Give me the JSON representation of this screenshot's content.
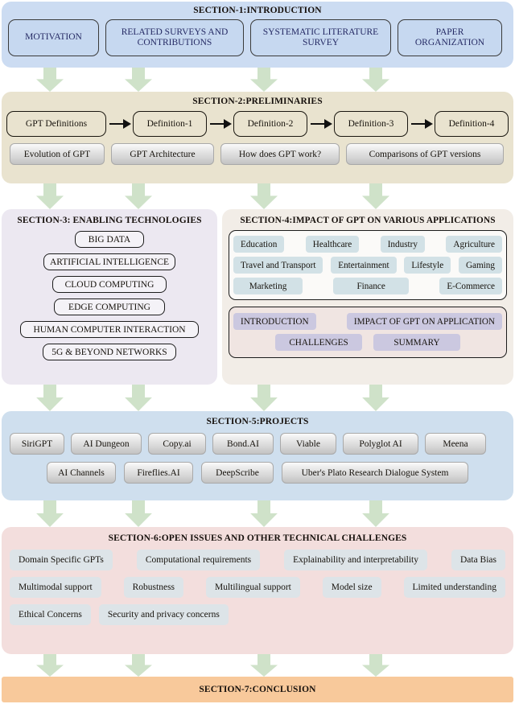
{
  "sections": {
    "s1": {
      "title": "SECTION-1:INTRODUCTION",
      "items": [
        "MOTIVATION",
        "RELATED SURVEYS AND CONTRIBUTIONS",
        "SYSTEMATIC LITERATURE SURVEY",
        "PAPER ORGANIZATION"
      ]
    },
    "s2": {
      "title": "SECTION-2:PRELIMINARIES",
      "flow": [
        "GPT Definitions",
        "Definition-1",
        "Definition-2",
        "Definition-3",
        "Definition-4"
      ],
      "topics": [
        "Evolution of GPT",
        "GPT Architecture",
        "How does GPT work?",
        "Comparisons of GPT versions"
      ]
    },
    "s3": {
      "title": "SECTION-3: ENABLING TECHNOLOGIES",
      "items": [
        "BIG DATA",
        "ARTIFICIAL INTELLIGENCE",
        "CLOUD COMPUTING",
        "EDGE COMPUTING",
        "HUMAN COMPUTER INTERACTION",
        "5G & BEYOND NETWORKS"
      ]
    },
    "s4": {
      "title": "SECTION-4:IMPACT OF GPT ON VARIOUS APPLICATIONS",
      "applications": [
        [
          "Education",
          "Healthcare",
          "Industry",
          "Agriculture"
        ],
        [
          "Travel and Transport",
          "Entertainment",
          "Lifestyle",
          "Gaming"
        ],
        [
          "Marketing",
          "Finance",
          "E-Commerce"
        ]
      ],
      "structure": [
        [
          "INTRODUCTION",
          "IMPACT OF GPT ON APPLICATION"
        ],
        [
          "CHALLENGES",
          "SUMMARY"
        ]
      ]
    },
    "s5": {
      "title": "SECTION-5:PROJECTS",
      "row1": [
        "SiriGPT",
        "AI Dungeon",
        "Copy.ai",
        "Bond.AI",
        "Viable",
        "Polyglot AI",
        "Meena"
      ],
      "row2": [
        "AI Channels",
        "Fireflies.AI",
        "DeepScribe",
        "Uber's Plato Research Dialogue System"
      ]
    },
    "s6": {
      "title": "SECTION-6:OPEN ISSUES AND OTHER TECHNICAL CHALLENGES",
      "row1": [
        "Domain Specific GPTs",
        "Computational requirements",
        "Explainability and interpretability",
        "Data Bias"
      ],
      "row2": [
        "Multimodal support",
        "Robustness",
        "Multilingual support",
        "Model size",
        "Limited understanding"
      ],
      "row3": [
        "Ethical Concerns",
        "Security and privacy concerns"
      ]
    },
    "s7": {
      "title": "SECTION-7:CONCLUSION"
    }
  },
  "colors": {
    "section1_bg": "#ccdcf2",
    "section2_bg": "#e9e3cf",
    "section3_bg": "#ece8f1",
    "section4_bg": "#f2ede7",
    "section5_bg": "#cfdfee",
    "section6_bg": "#f3dedd",
    "section7_bg": "#f8c99b",
    "arrow": "#cfe2c9",
    "chip_blue": "#d2e1e6",
    "chip_purple": "#cbc8e0",
    "chip_gray": "#dde4e8",
    "s1_box_text": "#252a64"
  }
}
